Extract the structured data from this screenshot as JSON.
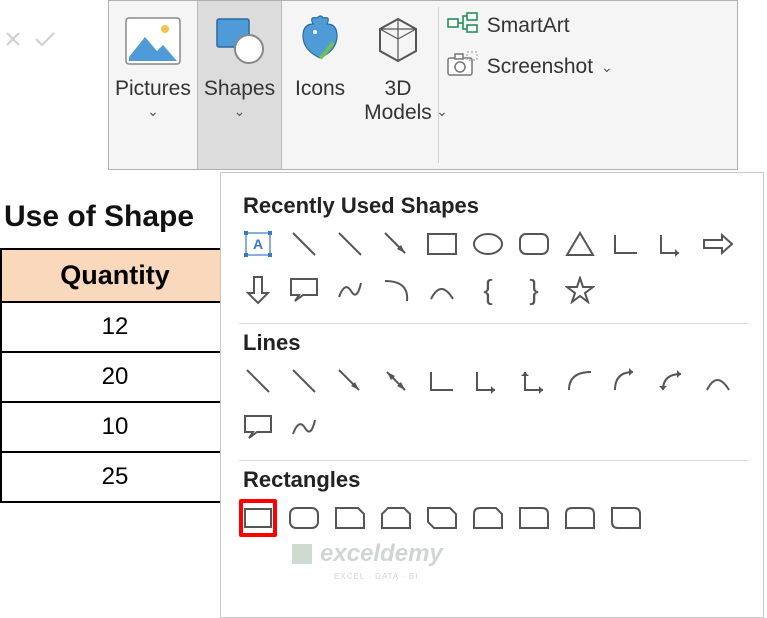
{
  "ribbon": {
    "pictures": "Pictures",
    "shapes": "Shapes",
    "icons": "Icons",
    "models": "3D\nModels",
    "smartart": "SmartArt",
    "screenshot": "Screenshot"
  },
  "sheet": {
    "title": "Use of Shape",
    "header": "Quantity",
    "rows": [
      "12",
      "20",
      "10",
      "25"
    ]
  },
  "panel": {
    "section_recent": "Recently Used Shapes",
    "section_lines": "Lines",
    "section_rect": "Rectangles"
  },
  "watermark": {
    "main": "exceldemy",
    "sub": "EXCEL · DATA · BI"
  }
}
